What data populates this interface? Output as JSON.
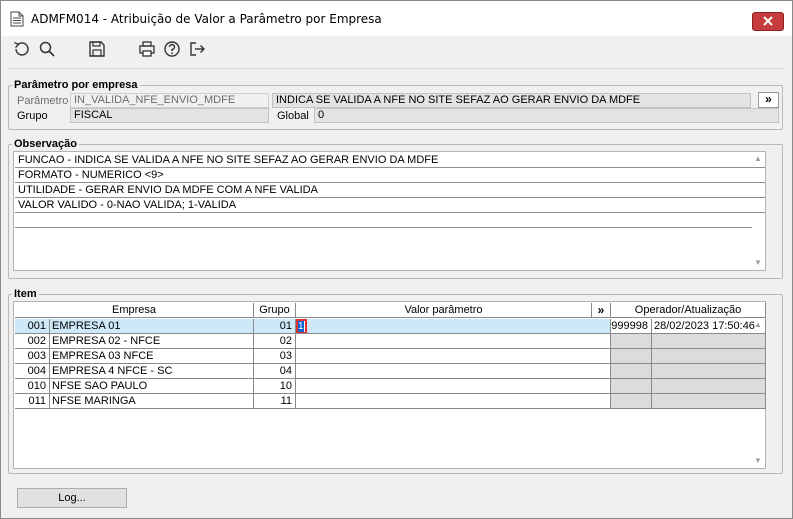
{
  "window": {
    "title": "ADMFM014 - Atribuição de Valor a Parâmetro por Empresa",
    "close_label": "✕"
  },
  "toolbar": {
    "icons": [
      "undo-icon",
      "search-icon",
      "save-icon",
      "print-icon",
      "help-icon",
      "exit-icon"
    ]
  },
  "parametro_empresa": {
    "legend": "Parâmetro por empresa",
    "parametro_label": "Parâmetro",
    "parametro_value": "IN_VALIDA_NFE_ENVIO_MDFE",
    "parametro_desc": "INDICA SE VALIDA A NFE NO SITE SEFAZ AO GERAR ENVIO DA MDFE",
    "expand_label": "»",
    "grupo_label": "Grupo",
    "grupo_value": "FISCAL",
    "global_label": "Global",
    "global_value": "0"
  },
  "observacao": {
    "legend": "Observação",
    "lines": [
      "FUNCAO - INDICA SE VALIDA A NFE NO SITE SEFAZ AO GERAR ENVIO DA MDFE",
      "FORMATO - NUMERICO <9>",
      "UTILIDADE - GERAR ENVIO DA MDFE COM A NFE VALIDA",
      "VALOR VALIDO - 0-NAO VALIDA; 1-VALIDA",
      ""
    ]
  },
  "item": {
    "legend": "Item",
    "headers": {
      "empresa": "Empresa",
      "grupo": "Grupo",
      "valor": "Valor parâmetro",
      "expand": "»",
      "operador": "Operador/Atualização"
    },
    "rows": [
      {
        "code": "001",
        "name": "EMPRESA 01",
        "grupo": "01",
        "valor": "1",
        "operador": "999998",
        "data": "28/02/2023 17:50:46"
      },
      {
        "code": "002",
        "name": "EMPRESA 02 - NFCE",
        "grupo": "02",
        "valor": "",
        "operador": "",
        "data": ""
      },
      {
        "code": "003",
        "name": "EMPRESA 03 NFCE",
        "grupo": "03",
        "valor": "",
        "operador": "",
        "data": ""
      },
      {
        "code": "004",
        "name": "EMPRESA 4 NFCE - SC",
        "grupo": "04",
        "valor": "",
        "operador": "",
        "data": ""
      },
      {
        "code": "010",
        "name": "NFSE SAO PAULO",
        "grupo": "10",
        "valor": "",
        "operador": "",
        "data": ""
      },
      {
        "code": "011",
        "name": "NFSE MARINGA",
        "grupo": "11",
        "valor": "",
        "operador": "",
        "data": ""
      }
    ]
  },
  "footer": {
    "log_label": "Log..."
  },
  "colors": {
    "selection": "#cde8f7",
    "readonly": "#dcdcdc",
    "close": "#c43c3c",
    "editor_border": "#e03030"
  }
}
